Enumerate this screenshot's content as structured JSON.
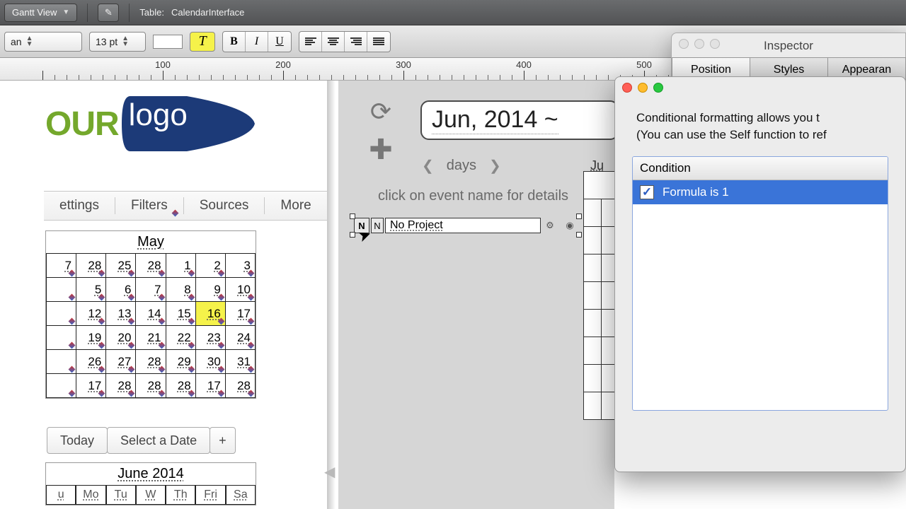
{
  "topbar": {
    "view_label": "Gantt View",
    "table_prefix": "Table:",
    "table_name": "CalendarInterface"
  },
  "format": {
    "font_name": "an",
    "font_size": "13 pt",
    "hl_glyph": "T"
  },
  "ruler": {
    "marks": [
      100,
      200,
      300,
      400,
      500
    ]
  },
  "logo": {
    "left_text": "OUR",
    "right_text": "logo"
  },
  "tabs": {
    "settings": "ettings",
    "filters": "Filters",
    "sources": "Sources",
    "more": "More"
  },
  "minical_may": {
    "title": "May",
    "rows": [
      [
        "7",
        "28",
        "25",
        "28",
        "1",
        "2",
        "3"
      ],
      [
        "",
        "5",
        "6",
        "7",
        "8",
        "9",
        "10"
      ],
      [
        "",
        "12",
        "13",
        "14",
        "15",
        "16",
        "17"
      ],
      [
        "",
        "19",
        "20",
        "21",
        "22",
        "23",
        "24"
      ],
      [
        "",
        "26",
        "27",
        "28",
        "29",
        "30",
        "31"
      ],
      [
        "",
        "17",
        "28",
        "28",
        "28",
        "17",
        "28"
      ]
    ],
    "today_row": 2,
    "today_col": 5
  },
  "buttons": {
    "today": "Today",
    "select_date": "Select a Date",
    "plus": "+"
  },
  "minical_june": {
    "title": "June 2014",
    "days": [
      "u",
      "Mo",
      "Tu",
      "W",
      "Th",
      "Fri",
      "Sa"
    ]
  },
  "center": {
    "month": "Jun, 2014 ~",
    "days_label": "days",
    "hint": "click on event name for details",
    "event_n": "N",
    "event_n2": "N",
    "event_label": "No Project"
  },
  "strips": {
    "head": "Ju"
  },
  "inspector": {
    "title": "Inspector",
    "tab_position": "Position",
    "tab_styles": "Styles",
    "tab_appear": "Appearan"
  },
  "cond": {
    "desc_line1": "Conditional formatting allows you t",
    "desc_line2": "(You can use the Self function to ref",
    "list_header": "Condition",
    "row_text": "Formula is 1"
  }
}
